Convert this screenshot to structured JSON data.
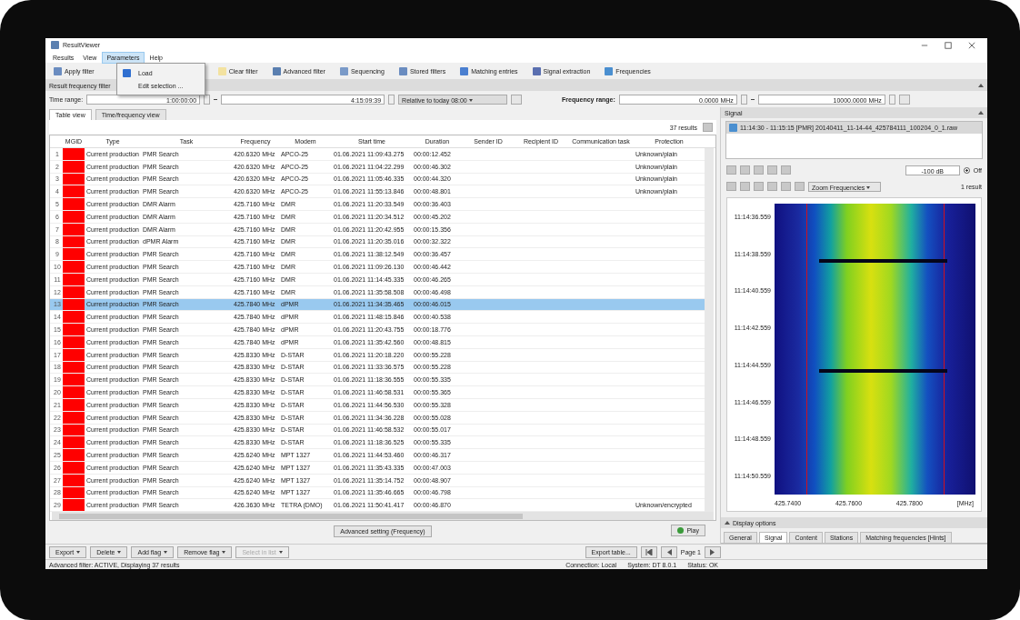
{
  "window": {
    "title": "ResultViewer"
  },
  "menu": [
    {
      "label": "Results",
      "open": false
    },
    {
      "label": "View",
      "open": false
    },
    {
      "label": "Parameters",
      "open": true
    },
    {
      "label": "Help",
      "open": false
    }
  ],
  "menu_dropdown": [
    "Load",
    "Edit selection ..."
  ],
  "toolbar": [
    "Apply filter",
    "Clear filter",
    "Advanced filter",
    "Sequencing",
    "Stored filters",
    "Matching entries",
    "Signal extraction",
    "Frequencies"
  ],
  "filter_section": "Result frequency filter",
  "filters": {
    "time_label": "Time range:",
    "time_from": "1:00:00:00",
    "time_to": "4:15:09:39",
    "relative": "Relative to today 08:00",
    "frequency_label": "Frequency range:",
    "freq_from": "0.0000 MHz",
    "freq_to": "10000.0000 MHz"
  },
  "tabs": [
    {
      "label": "Table view",
      "selected": true
    },
    {
      "label": "Time/frequency view",
      "selected": false
    }
  ],
  "result_count": "37 results",
  "table": {
    "columns": [
      "",
      "MGID",
      "Type",
      "Task",
      "Frequency",
      "Modem",
      "Start time",
      "Duration",
      "Sender ID",
      "Recipient ID",
      "Communication task",
      "Protection"
    ],
    "rows": [
      {
        "n": "1",
        "color": "#ff0000",
        "selected": false,
        "type": "Current production",
        "task": "PMR Search",
        "freq": "420.6320 MHz",
        "modem": "APCO-25",
        "start": "01.06.2021 11:09:43.275",
        "dur": "00:00:12.452",
        "prot": "Unknown/plain"
      },
      {
        "n": "2",
        "color": "#ff0000",
        "selected": false,
        "type": "Current production",
        "task": "PMR Search",
        "freq": "420.6320 MHz",
        "modem": "APCO-25",
        "start": "01.06.2021 11:04:22.299",
        "dur": "00:00:46.302",
        "prot": "Unknown/plain"
      },
      {
        "n": "3",
        "color": "#ff0000",
        "selected": false,
        "type": "Current production",
        "task": "PMR Search",
        "freq": "420.6320 MHz",
        "modem": "APCO-25",
        "start": "01.06.2021 11:05:46.335",
        "dur": "00:00:44.320",
        "prot": "Unknown/plain"
      },
      {
        "n": "4",
        "color": "#ff0000",
        "selected": false,
        "type": "Current production",
        "task": "PMR Search",
        "freq": "420.6320 MHz",
        "modem": "APCO-25",
        "start": "01.06.2021 11:55:13.846",
        "dur": "00:00:48.801",
        "prot": "Unknown/plain"
      },
      {
        "n": "5",
        "color": "#ff0000",
        "selected": false,
        "type": "Current production",
        "task": "DMR Alarm",
        "freq": "425.7160 MHz",
        "modem": "DMR",
        "start": "01.06.2021 11:20:33.549",
        "dur": "00:00:36.403",
        "prot": ""
      },
      {
        "n": "6",
        "color": "#ff0000",
        "selected": false,
        "type": "Current production",
        "task": "DMR Alarm",
        "freq": "425.7160 MHz",
        "modem": "DMR",
        "start": "01.06.2021 11:20:34.512",
        "dur": "00:00:45.202",
        "prot": ""
      },
      {
        "n": "7",
        "color": "#ff0000",
        "selected": false,
        "type": "Current production",
        "task": "DMR Alarm",
        "freq": "425.7160 MHz",
        "modem": "DMR",
        "start": "01.06.2021 11:20:42.955",
        "dur": "00:00:15.356",
        "prot": ""
      },
      {
        "n": "8",
        "color": "#ff0000",
        "selected": false,
        "type": "Current production",
        "task": "dPMR Alarm",
        "freq": "425.7160 MHz",
        "modem": "DMR",
        "start": "01.06.2021 11:20:35.016",
        "dur": "00:00:32.322",
        "prot": ""
      },
      {
        "n": "9",
        "color": "#ff0000",
        "selected": false,
        "type": "Current production",
        "task": "PMR Search",
        "freq": "425.7160 MHz",
        "modem": "DMR",
        "start": "01.06.2021 11:38:12.549",
        "dur": "00:00:36.457",
        "prot": ""
      },
      {
        "n": "10",
        "color": "#ff0000",
        "selected": false,
        "type": "Current production",
        "task": "PMR Search",
        "freq": "425.7160 MHz",
        "modem": "DMR",
        "start": "01.06.2021 11:09:26.130",
        "dur": "00:00:46.442",
        "prot": ""
      },
      {
        "n": "11",
        "color": "#ff0000",
        "selected": false,
        "type": "Current production",
        "task": "PMR Search",
        "freq": "425.7160 MHz",
        "modem": "DMR",
        "start": "01.06.2021 11:14:45.335",
        "dur": "00:00:46.265",
        "prot": ""
      },
      {
        "n": "12",
        "color": "#ff0000",
        "selected": false,
        "type": "Current production",
        "task": "PMR Search",
        "freq": "425.7160 MHz",
        "modem": "DMR",
        "start": "01.06.2021 11:35:58.508",
        "dur": "00:00:46.498",
        "prot": ""
      },
      {
        "n": "13",
        "color": "#ff0000",
        "selected": true,
        "type": "Current production",
        "task": "PMR Search",
        "freq": "425.7840 MHz",
        "modem": "dPMR",
        "start": "01.06.2021 11:34:35.465",
        "dur": "00:00:46.015",
        "prot": ""
      },
      {
        "n": "14",
        "color": "#ff0000",
        "selected": false,
        "type": "Current production",
        "task": "PMR Search",
        "freq": "425.7840 MHz",
        "modem": "dPMR",
        "start": "01.06.2021 11:48:15.846",
        "dur": "00:00:40.538",
        "prot": ""
      },
      {
        "n": "15",
        "color": "#ff0000",
        "selected": false,
        "type": "Current production",
        "task": "PMR Search",
        "freq": "425.7840 MHz",
        "modem": "dPMR",
        "start": "01.06.2021 11:20:43.755",
        "dur": "00:00:18.776",
        "prot": ""
      },
      {
        "n": "16",
        "color": "#ff0000",
        "selected": false,
        "type": "Current production",
        "task": "PMR Search",
        "freq": "425.7840 MHz",
        "modem": "dPMR",
        "start": "01.06.2021 11:35:42.560",
        "dur": "00:00:48.815",
        "prot": ""
      },
      {
        "n": "17",
        "color": "#ff0000",
        "selected": false,
        "type": "Current production",
        "task": "PMR Search",
        "freq": "425.8330 MHz",
        "modem": "D-STAR",
        "start": "01.06.2021 11:20:18.220",
        "dur": "00:00:55.228",
        "prot": ""
      },
      {
        "n": "18",
        "color": "#ff0000",
        "selected": false,
        "type": "Current production",
        "task": "PMR Search",
        "freq": "425.8330 MHz",
        "modem": "D-STAR",
        "start": "01.06.2021 11:33:36.575",
        "dur": "00:00:55.228",
        "prot": ""
      },
      {
        "n": "19",
        "color": "#ff0000",
        "selected": false,
        "type": "Current production",
        "task": "PMR Search",
        "freq": "425.8330 MHz",
        "modem": "D-STAR",
        "start": "01.06.2021 11:18:36.555",
        "dur": "00:00:55.335",
        "prot": ""
      },
      {
        "n": "20",
        "color": "#ff0000",
        "selected": false,
        "type": "Current production",
        "task": "PMR Search",
        "freq": "425.8330 MHz",
        "modem": "D-STAR",
        "start": "01.06.2021 11:46:58.531",
        "dur": "00:00:55.365",
        "prot": ""
      },
      {
        "n": "21",
        "color": "#ff0000",
        "selected": false,
        "type": "Current production",
        "task": "PMR Search",
        "freq": "425.8330 MHz",
        "modem": "D-STAR",
        "start": "01.06.2021 11:44:56.530",
        "dur": "00:00:55.328",
        "prot": ""
      },
      {
        "n": "22",
        "color": "#ff0000",
        "selected": false,
        "type": "Current production",
        "task": "PMR Search",
        "freq": "425.8330 MHz",
        "modem": "D-STAR",
        "start": "01.06.2021 11:34:36.228",
        "dur": "00:00:55.028",
        "prot": ""
      },
      {
        "n": "23",
        "color": "#ff0000",
        "selected": false,
        "type": "Current production",
        "task": "PMR Search",
        "freq": "425.8330 MHz",
        "modem": "D-STAR",
        "start": "01.06.2021 11:46:58.532",
        "dur": "00:00:55.017",
        "prot": ""
      },
      {
        "n": "24",
        "color": "#ff0000",
        "selected": false,
        "type": "Current production",
        "task": "PMR Search",
        "freq": "425.8330 MHz",
        "modem": "D-STAR",
        "start": "01.06.2021 11:18:36.525",
        "dur": "00:00:55.335",
        "prot": ""
      },
      {
        "n": "25",
        "color": "#ff0000",
        "selected": false,
        "type": "Current production",
        "task": "PMR Search",
        "freq": "425.6240 MHz",
        "modem": "MPT 1327",
        "start": "01.06.2021 11:44:53.460",
        "dur": "00:00:46.317",
        "prot": ""
      },
      {
        "n": "26",
        "color": "#ff0000",
        "selected": false,
        "type": "Current production",
        "task": "PMR Search",
        "freq": "425.6240 MHz",
        "modem": "MPT 1327",
        "start": "01.06.2021 11:35:43.335",
        "dur": "00:00:47.003",
        "prot": ""
      },
      {
        "n": "27",
        "color": "#ff0000",
        "selected": false,
        "type": "Current production",
        "task": "PMR Search",
        "freq": "425.6240 MHz",
        "modem": "MPT 1327",
        "start": "01.06.2021 11:35:14.752",
        "dur": "00:00:48.907",
        "prot": ""
      },
      {
        "n": "28",
        "color": "#ff0000",
        "selected": false,
        "type": "Current production",
        "task": "PMR Search",
        "freq": "425.6240 MHz",
        "modem": "MPT 1327",
        "start": "01.06.2021 11:35:46.665",
        "dur": "00:00:46.798",
        "prot": ""
      },
      {
        "n": "29",
        "color": "#ff0000",
        "selected": false,
        "type": "Current production",
        "task": "PMR Search",
        "freq": "426.3630 MHz",
        "modem": "TETRA (DMO)",
        "start": "01.06.2021 11:50:41.417",
        "dur": "00:00:46.870",
        "prot": "Unknown/encrypted"
      }
    ]
  },
  "advanced_settings": "Advanced setting (Frequency)",
  "play": "Play",
  "bottom_buttons": [
    {
      "label": "Export",
      "disabled": false
    },
    {
      "label": "Delete",
      "disabled": false
    },
    {
      "label": "Add flag",
      "disabled": false
    },
    {
      "label": "Remove flag",
      "disabled": false
    },
    {
      "label": "Select in list",
      "disabled": true
    }
  ],
  "export_table": "Export table...",
  "pager": "Page 1",
  "status_bar": {
    "left": "Advanced filter: ACTIVE, Displaying 37 results",
    "connection": "Connection: Local",
    "system": "System: DT 8.0.1",
    "status": "Status: OK"
  },
  "signal": {
    "title": "Signal",
    "file": "11:14:30 - 11:15:15 [PMR] 20140411_11-14-44_425784111_100204_0_1.raw",
    "level_field": "-100 dB",
    "off": "Off",
    "zoom": "Zoom Frequencies",
    "results": "1 result",
    "times": [
      "11:14:36.559",
      "11:14:38.559",
      "11:14:40.559",
      "11:14:42.559",
      "11:14:44.559",
      "11:14:46.559",
      "11:14:48.559",
      "11:14:50.559"
    ],
    "freqs": [
      "425.7400",
      "425.7600",
      "425.7800",
      "[MHz]"
    ]
  },
  "display_options": {
    "title": "Display options",
    "tabs": [
      {
        "label": "General",
        "selected": false
      },
      {
        "label": "Signal",
        "selected": true
      },
      {
        "label": "Content",
        "selected": false
      },
      {
        "label": "Stations",
        "selected": false
      },
      {
        "label": "Matching frequencies [Hints]",
        "selected": false
      }
    ]
  }
}
